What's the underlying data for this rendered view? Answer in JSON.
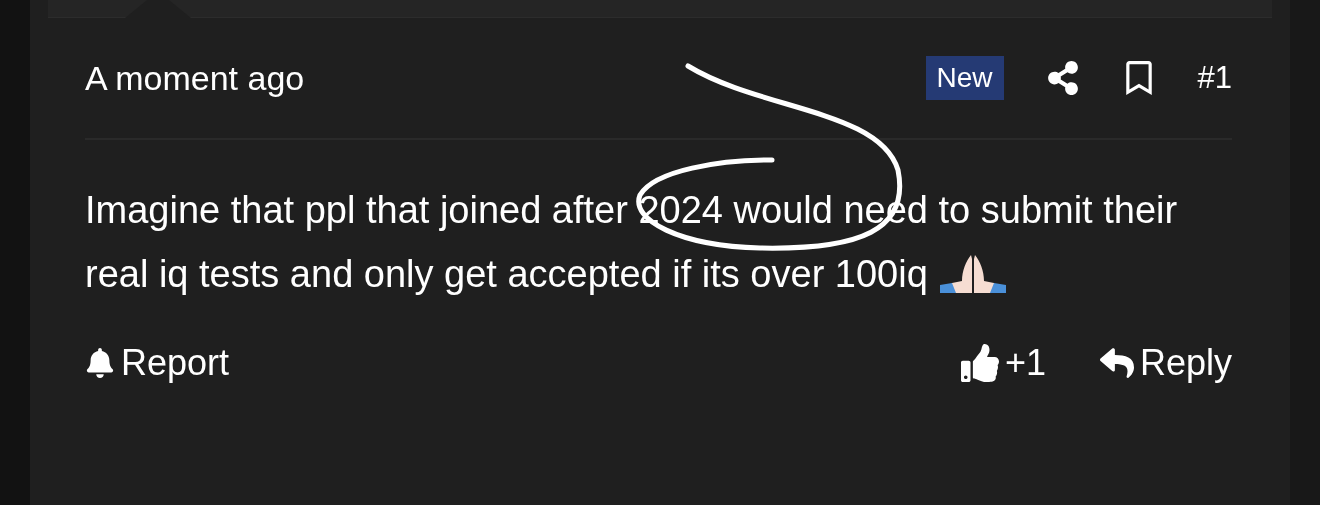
{
  "post": {
    "time": "A moment ago",
    "badge": "New",
    "number": "#1",
    "body": "Imagine that ppl that joined after 2024 would need to submit their real iq tests and only get accepted if its over 100iq",
    "actions": {
      "report": "Report",
      "like": "+1",
      "reply": "Reply"
    }
  }
}
